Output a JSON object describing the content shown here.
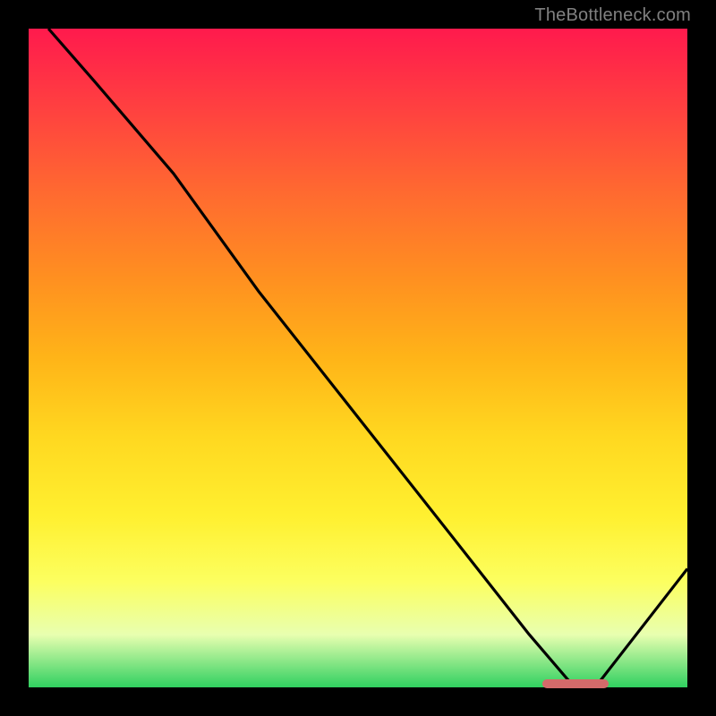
{
  "attribution": "TheBottleneck.com",
  "colors": {
    "bg": "#000000",
    "curve": "#000000",
    "marker": "#d46a6a"
  },
  "chart_data": {
    "type": "line",
    "title": "",
    "xlabel": "",
    "ylabel": "",
    "xlim": [
      0,
      100
    ],
    "ylim": [
      0,
      100
    ],
    "grid": false,
    "legend": false,
    "x": [
      3,
      10,
      22,
      35,
      50,
      65,
      76,
      82,
      86,
      100
    ],
    "values": [
      100,
      92,
      78,
      60,
      41,
      22,
      8,
      1,
      0,
      18
    ],
    "annotations": [
      {
        "type": "marker-band",
        "x_start": 78,
        "x_end": 88,
        "y": 0.5
      }
    ],
    "background_gradient": {
      "direction": "vertical",
      "stops": [
        {
          "pos": 0.0,
          "color": "#ff1a4d"
        },
        {
          "pos": 0.12,
          "color": "#ff4040"
        },
        {
          "pos": 0.25,
          "color": "#ff6a30"
        },
        {
          "pos": 0.38,
          "color": "#ff9020"
        },
        {
          "pos": 0.5,
          "color": "#ffb418"
        },
        {
          "pos": 0.62,
          "color": "#ffd820"
        },
        {
          "pos": 0.74,
          "color": "#fff030"
        },
        {
          "pos": 0.84,
          "color": "#fcff60"
        },
        {
          "pos": 0.92,
          "color": "#e8ffb0"
        },
        {
          "pos": 1.0,
          "color": "#30d060"
        }
      ]
    }
  }
}
